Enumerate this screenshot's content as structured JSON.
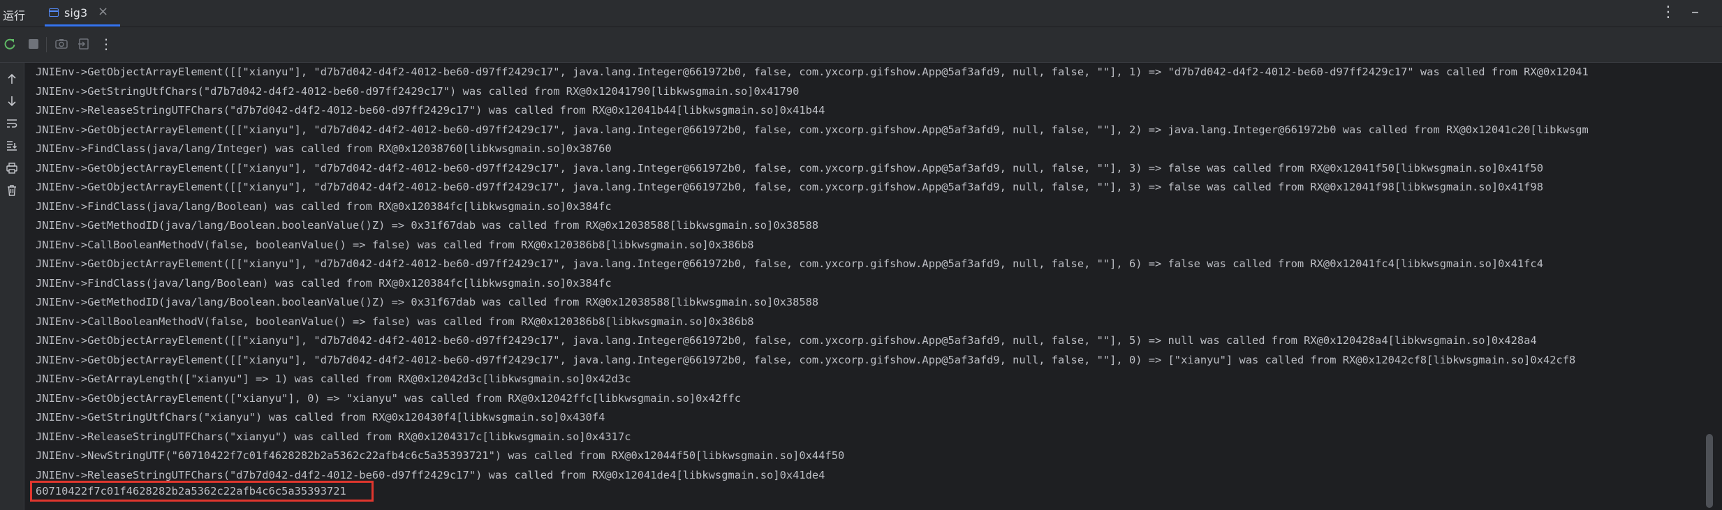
{
  "header": {
    "run_label": "运行",
    "tab": {
      "label": "sig3",
      "close": "×"
    },
    "more_glyph": "⋮",
    "minimize_glyph": "–"
  },
  "toolbar": {
    "icons": [
      "rerun-icon",
      "stop-icon",
      "camera-icon",
      "exit-icon",
      "more-icon"
    ]
  },
  "sidebar": {
    "icons": [
      "up-arrow-icon",
      "down-arrow-icon",
      "soft-wrap-icon",
      "scroll-to-end-icon",
      "print-icon",
      "trash-icon"
    ]
  },
  "console": {
    "lines": [
      "JNIEnv->GetObjectArrayElement([[\"xianyu\"], \"d7b7d042-d4f2-4012-be60-d97ff2429c17\", java.lang.Integer@661972b0, false, com.yxcorp.gifshow.App@5af3afd9, null, false, \"\"], 1) => \"d7b7d042-d4f2-4012-be60-d97ff2429c17\" was called from RX@0x12041",
      "JNIEnv->GetStringUtfChars(\"d7b7d042-d4f2-4012-be60-d97ff2429c17\") was called from RX@0x12041790[libkwsgmain.so]0x41790",
      "JNIEnv->ReleaseStringUTFChars(\"d7b7d042-d4f2-4012-be60-d97ff2429c17\") was called from RX@0x12041b44[libkwsgmain.so]0x41b44",
      "JNIEnv->GetObjectArrayElement([[\"xianyu\"], \"d7b7d042-d4f2-4012-be60-d97ff2429c17\", java.lang.Integer@661972b0, false, com.yxcorp.gifshow.App@5af3afd9, null, false, \"\"], 2) => java.lang.Integer@661972b0 was called from RX@0x12041c20[libkwsgm",
      "JNIEnv->FindClass(java/lang/Integer) was called from RX@0x12038760[libkwsgmain.so]0x38760",
      "JNIEnv->GetObjectArrayElement([[\"xianyu\"], \"d7b7d042-d4f2-4012-be60-d97ff2429c17\", java.lang.Integer@661972b0, false, com.yxcorp.gifshow.App@5af3afd9, null, false, \"\"], 3) => false was called from RX@0x12041f50[libkwsgmain.so]0x41f50",
      "JNIEnv->GetObjectArrayElement([[\"xianyu\"], \"d7b7d042-d4f2-4012-be60-d97ff2429c17\", java.lang.Integer@661972b0, false, com.yxcorp.gifshow.App@5af3afd9, null, false, \"\"], 3) => false was called from RX@0x12041f98[libkwsgmain.so]0x41f98",
      "JNIEnv->FindClass(java/lang/Boolean) was called from RX@0x120384fc[libkwsgmain.so]0x384fc",
      "JNIEnv->GetMethodID(java/lang/Boolean.booleanValue()Z) => 0x31f67dab was called from RX@0x12038588[libkwsgmain.so]0x38588",
      "JNIEnv->CallBooleanMethodV(false, booleanValue() => false) was called from RX@0x120386b8[libkwsgmain.so]0x386b8",
      "JNIEnv->GetObjectArrayElement([[\"xianyu\"], \"d7b7d042-d4f2-4012-be60-d97ff2429c17\", java.lang.Integer@661972b0, false, com.yxcorp.gifshow.App@5af3afd9, null, false, \"\"], 6) => false was called from RX@0x12041fc4[libkwsgmain.so]0x41fc4",
      "JNIEnv->FindClass(java/lang/Boolean) was called from RX@0x120384fc[libkwsgmain.so]0x384fc",
      "JNIEnv->GetMethodID(java/lang/Boolean.booleanValue()Z) => 0x31f67dab was called from RX@0x12038588[libkwsgmain.so]0x38588",
      "JNIEnv->CallBooleanMethodV(false, booleanValue() => false) was called from RX@0x120386b8[libkwsgmain.so]0x386b8",
      "JNIEnv->GetObjectArrayElement([[\"xianyu\"], \"d7b7d042-d4f2-4012-be60-d97ff2429c17\", java.lang.Integer@661972b0, false, com.yxcorp.gifshow.App@5af3afd9, null, false, \"\"], 5) => null was called from RX@0x120428a4[libkwsgmain.so]0x428a4",
      "JNIEnv->GetObjectArrayElement([[\"xianyu\"], \"d7b7d042-d4f2-4012-be60-d97ff2429c17\", java.lang.Integer@661972b0, false, com.yxcorp.gifshow.App@5af3afd9, null, false, \"\"], 0) => [\"xianyu\"] was called from RX@0x12042cf8[libkwsgmain.so]0x42cf8",
      "JNIEnv->GetArrayLength([\"xianyu\"] => 1) was called from RX@0x12042d3c[libkwsgmain.so]0x42d3c",
      "JNIEnv->GetObjectArrayElement([\"xianyu\"], 0) => \"xianyu\" was called from RX@0x12042ffc[libkwsgmain.so]0x42ffc",
      "JNIEnv->GetStringUtfChars(\"xianyu\") was called from RX@0x120430f4[libkwsgmain.so]0x430f4",
      "JNIEnv->ReleaseStringUTFChars(\"xianyu\") was called from RX@0x1204317c[libkwsgmain.so]0x4317c",
      "JNIEnv->NewStringUTF(\"60710422f7c01f4628282b2a5362c22afb4c6c5a35393721\") was called from RX@0x12044f50[libkwsgmain.so]0x44f50",
      "JNIEnv->ReleaseStringUTFChars(\"d7b7d042-d4f2-4012-be60-d97ff2429c17\") was called from RX@0x12041de4[libkwsgmain.so]0x41de4",
      "60710422f7c01f4628282b2a5362c22afb4c6c5a35393721"
    ]
  }
}
